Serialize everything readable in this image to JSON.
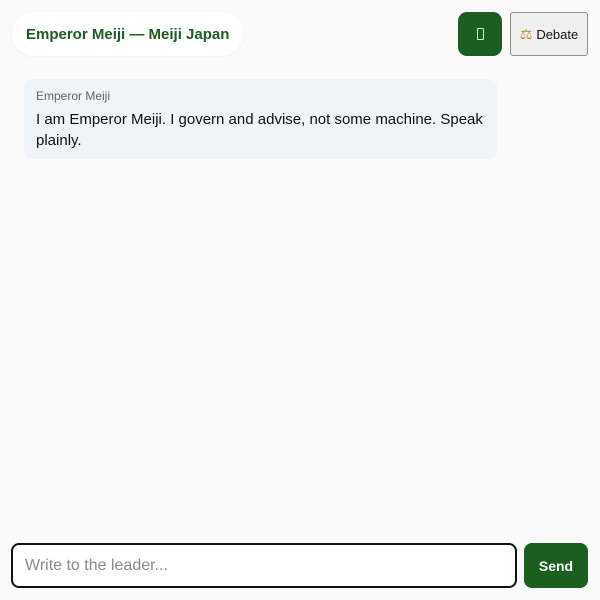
{
  "header": {
    "title": "Emperor Meiji — Meiji Japan",
    "icon_button_icon": "missing-glyph-icon",
    "debate_icon": "balance-scale-icon",
    "debate_label": "Debate"
  },
  "messages": [
    {
      "sender": "Emperor Meiji",
      "text": "I am Emperor Meiji. I govern and advise, not some machine. Speak plainly."
    }
  ],
  "composer": {
    "value": "",
    "placeholder": "Write to the leader...",
    "send_label": "Send"
  },
  "colors": {
    "accent": "#1b5e20",
    "background": "#fafafa",
    "message_bubble": "#f0f3f8"
  }
}
